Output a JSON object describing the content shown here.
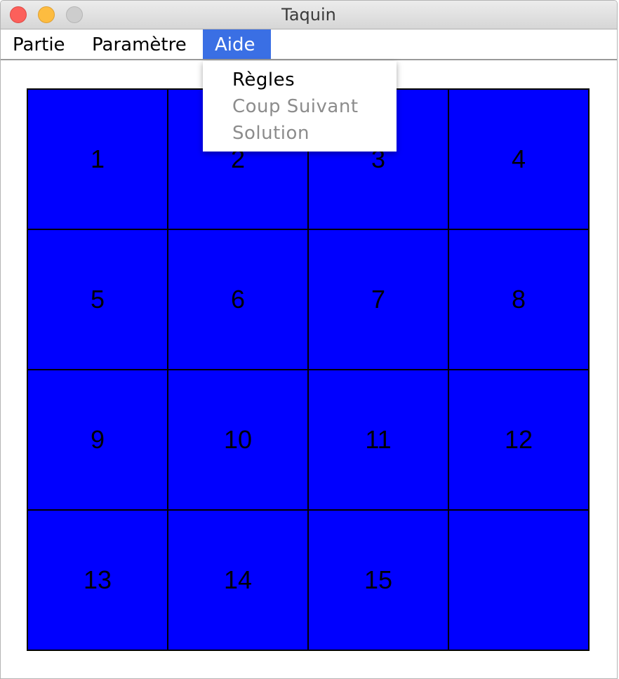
{
  "window": {
    "title": "Taquin"
  },
  "menubar": {
    "items": [
      {
        "label": "Partie"
      },
      {
        "label": "Paramètre"
      },
      {
        "label": "Aide"
      }
    ],
    "active": "Aide"
  },
  "dropdown": {
    "items": [
      {
        "label": "Règles",
        "enabled": true
      },
      {
        "label": "Coup Suivant",
        "enabled": false
      },
      {
        "label": "Solution",
        "enabled": false
      }
    ]
  },
  "board": {
    "rows": 4,
    "cols": 4,
    "tiles": [
      "1",
      "2",
      "3",
      "4",
      "5",
      "6",
      "7",
      "8",
      "9",
      "10",
      "11",
      "12",
      "13",
      "14",
      "15",
      ""
    ],
    "tile_color": "#0000ff",
    "border_color": "#000000"
  },
  "colors": {
    "menu_highlight": "#3a6fe4",
    "close": "#fc605b",
    "minimize": "#fdbc40",
    "zoom_disabled": "#cdcdcd"
  }
}
